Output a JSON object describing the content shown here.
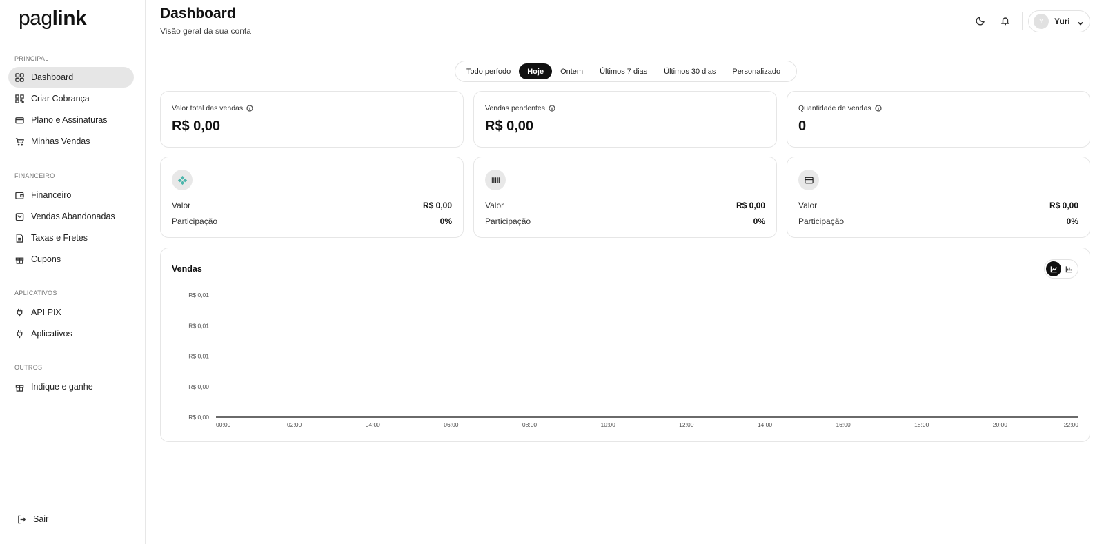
{
  "brand": {
    "logo_part1": "pag",
    "logo_part2": "link"
  },
  "sidebar": {
    "sections": [
      {
        "label": "PRINCIPAL"
      },
      {
        "label": "FINANCEIRO"
      },
      {
        "label": "APLICATIVOS"
      },
      {
        "label": "OUTROS"
      }
    ],
    "items": [
      {
        "label": "Dashboard",
        "icon": "dashboard-icon"
      },
      {
        "label": "Criar Cobrança",
        "icon": "qr-code-icon"
      },
      {
        "label": "Plano e Assinaturas",
        "icon": "card-icon"
      },
      {
        "label": "Minhas Vendas",
        "icon": "cart-icon"
      },
      {
        "label": "Financeiro",
        "icon": "wallet-icon"
      },
      {
        "label": "Vendas Abandonadas",
        "icon": "bag-icon"
      },
      {
        "label": "Taxas e Fretes",
        "icon": "document-icon"
      },
      {
        "label": "Cupons",
        "icon": "gift-icon"
      },
      {
        "label": "API PIX",
        "icon": "plug-icon"
      },
      {
        "label": "Aplicativos",
        "icon": "plug-icon"
      },
      {
        "label": "Indique e ganhe",
        "icon": "gift-icon"
      }
    ],
    "logout_label": "Sair"
  },
  "header": {
    "title": "Dashboard",
    "subtitle": "Visão geral da sua conta",
    "user_initial": "Y",
    "user_name": "Yuri"
  },
  "period_tabs": [
    "Todo período",
    "Hoje",
    "Ontem",
    "Últimos 7 dias",
    "Últimos 30 dias",
    "Personalizado"
  ],
  "active_period": "Hoje",
  "stats": [
    {
      "label": "Valor total das vendas",
      "value": "R$ 0,00"
    },
    {
      "label": "Vendas pendentes",
      "value": "R$ 0,00"
    },
    {
      "label": "Quantidade de vendas",
      "value": "0"
    }
  ],
  "payment_methods": [
    {
      "icon": "pix-icon",
      "value_label": "Valor",
      "value": "R$ 0,00",
      "share_label": "Participação",
      "share": "0%"
    },
    {
      "icon": "barcode-icon",
      "value_label": "Valor",
      "value": "R$ 0,00",
      "share_label": "Participação",
      "share": "0%"
    },
    {
      "icon": "credit-card-icon",
      "value_label": "Valor",
      "value": "R$ 0,00",
      "share_label": "Participação",
      "share": "0%"
    }
  ],
  "colors": {
    "pix": "#4db6ac",
    "active": "#111111"
  },
  "chart_data": {
    "type": "line",
    "title": "Vendas",
    "x": [
      "00:00",
      "02:00",
      "04:00",
      "06:00",
      "08:00",
      "10:00",
      "12:00",
      "14:00",
      "16:00",
      "18:00",
      "20:00",
      "22:00"
    ],
    "series": [
      {
        "values": [
          0,
          0,
          0,
          0,
          0,
          0,
          0,
          0,
          0,
          0,
          0,
          0
        ]
      }
    ],
    "y_ticks": [
      "R$ 0,01",
      "R$ 0,01",
      "R$ 0,01",
      "R$ 0,00",
      "R$ 0,00"
    ],
    "ylim": [
      0,
      0.01
    ],
    "grid": false,
    "xlabel": "",
    "ylabel": ""
  }
}
